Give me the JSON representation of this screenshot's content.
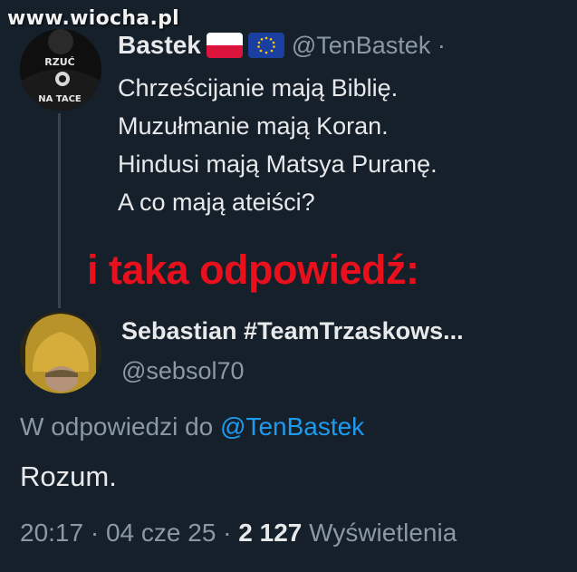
{
  "watermark": "www.wiocha.pl",
  "tweet": {
    "author_name": "Bastek",
    "handle": "@TenBastek",
    "handle_separator": "·",
    "flags": [
      "poland-flag-icon",
      "eu-flag-icon"
    ],
    "lines": [
      "Chrześcijanie mają Biblię.",
      "Muzułmanie mają Koran.",
      "Hindusi mają Matsya Puranę.",
      "A co mają ateiści?"
    ],
    "avatar_text": [
      "RZUĆ",
      "NA TACE"
    ]
  },
  "caption": "i taka odpowiedź:",
  "reply": {
    "author_name": "Sebastian #TeamTrzaskows...",
    "handle": "@sebsol70",
    "context_prefix": "W odpowiedzi do",
    "context_mention": "@TenBastek",
    "text": "Rozum.",
    "time": "20:17",
    "sep1": " · ",
    "date": "04 cze 25",
    "sep2": " · ",
    "views_count": "2 127",
    "views_label": " Wyświetlenia"
  },
  "colors": {
    "background": "#15202b",
    "text": "#e7e9ea",
    "secondary": "#8b98a5",
    "link": "#1d9bf0",
    "caption_red": "#e8101c"
  }
}
